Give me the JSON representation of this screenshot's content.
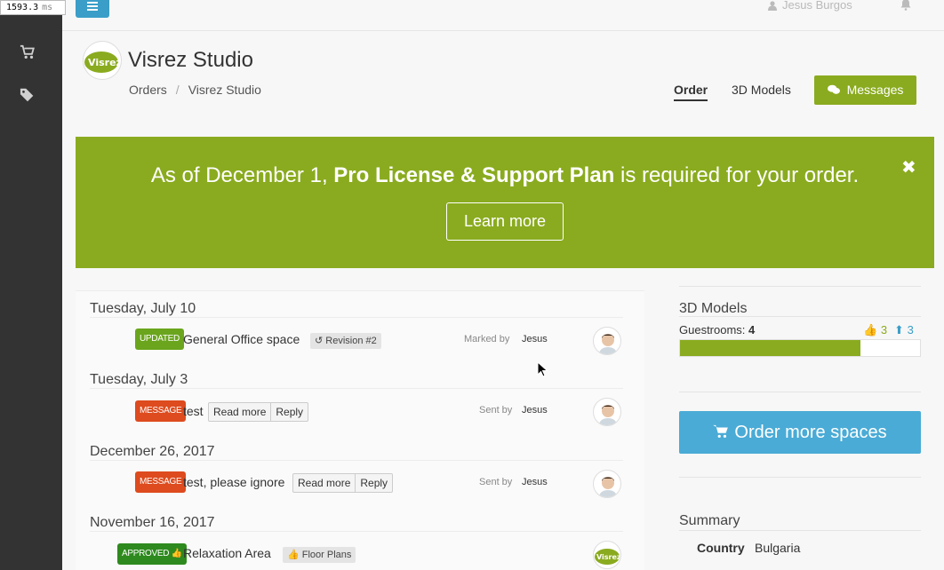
{
  "timer": {
    "value": "1593.3",
    "unit": "ms"
  },
  "topbar": {
    "user_name": "Jesus Burgos"
  },
  "header": {
    "logo_text": "Visrez",
    "title": "Visrez Studio",
    "breadcrumb": [
      "Orders",
      "Visrez Studio"
    ],
    "breadcrumb_sep": "/",
    "tabs": [
      {
        "label": "Order",
        "active": true
      },
      {
        "label": "3D Models",
        "active": false
      }
    ],
    "messages_button": "Messages"
  },
  "banner": {
    "text_before": "As of December 1, ",
    "text_bold": "Pro License & Support Plan",
    "text_after": " is required for your order.",
    "button": "Learn more",
    "close": "✖"
  },
  "feed": [
    {
      "date": "Tuesday, July 10",
      "badge": "UPDATED",
      "title": "General Office space",
      "tag": "Revision #2",
      "meta": "Marked by",
      "who": "Jesus"
    },
    {
      "date": "Tuesday, July 3",
      "badge": "MESSAGE",
      "title": "test",
      "actions": [
        "Read more",
        "Reply"
      ],
      "meta": "Sent by",
      "who": "Jesus"
    },
    {
      "date": "December 26, 2017",
      "badge": "MESSAGE",
      "title": "test, please ignore",
      "actions": [
        "Read more",
        "Reply"
      ],
      "meta": "Sent by",
      "who": "Jesus"
    },
    {
      "date": "November 16, 2017",
      "badge": "APPROVED",
      "title": "Relaxation Area",
      "tag": "Floor Plans"
    }
  ],
  "models": {
    "title": "3D Models",
    "guestrooms_label": "Guestrooms:",
    "guestrooms_count": "4",
    "upvotes": "3",
    "updates": "3",
    "progress_fraction": 0.75
  },
  "order_button": "Order more spaces",
  "summary": {
    "title": "Summary",
    "rows": [
      {
        "label": "Country",
        "value": "Bulgaria"
      }
    ]
  },
  "colors": {
    "accent_green": "#8aab1f",
    "accent_blue": "#4aabd6",
    "sidebar": "#333333",
    "message_red": "#dd4b1e"
  }
}
